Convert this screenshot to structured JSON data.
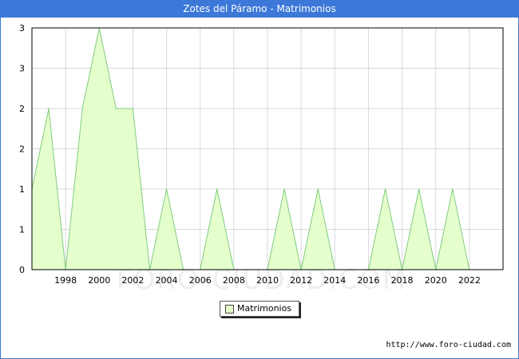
{
  "title": "Zotes del Páramo - Matrimonios",
  "watermark": "FORO-CIUDAD.COM",
  "source": "http://www.foro-ciudad.com",
  "colors": {
    "titlebar": "#3c78d8",
    "fill": "#e5ffcc",
    "line": "#7fcc7f",
    "grid": "#d9d9d9"
  },
  "chart_data": {
    "type": "area",
    "x": [
      1996,
      1997,
      1998,
      1999,
      2000,
      2001,
      2002,
      2003,
      2004,
      2005,
      2006,
      2007,
      2008,
      2009,
      2010,
      2011,
      2012,
      2013,
      2014,
      2015,
      2016,
      2017,
      2018,
      2019,
      2020,
      2021,
      2022
    ],
    "series": [
      {
        "name": "Matrimonios",
        "values": [
          1,
          2,
          0,
          2,
          3,
          2,
          2,
          0,
          1,
          0,
          0,
          1,
          0,
          0,
          0,
          1,
          0,
          1,
          0,
          0,
          0,
          1,
          0,
          1,
          0,
          1,
          0
        ]
      }
    ],
    "x_ticks": [
      "1998",
      "2000",
      "2002",
      "2004",
      "2006",
      "2008",
      "2010",
      "2012",
      "2014",
      "2016",
      "2018",
      "2020",
      "2022"
    ],
    "y_ticks": [
      "0",
      "1",
      "1",
      "2",
      "2",
      "3",
      "3"
    ],
    "xlim": [
      1996,
      2024
    ],
    "ylim": [
      0,
      3
    ],
    "grid": true,
    "legend_position": "bottom-center"
  }
}
